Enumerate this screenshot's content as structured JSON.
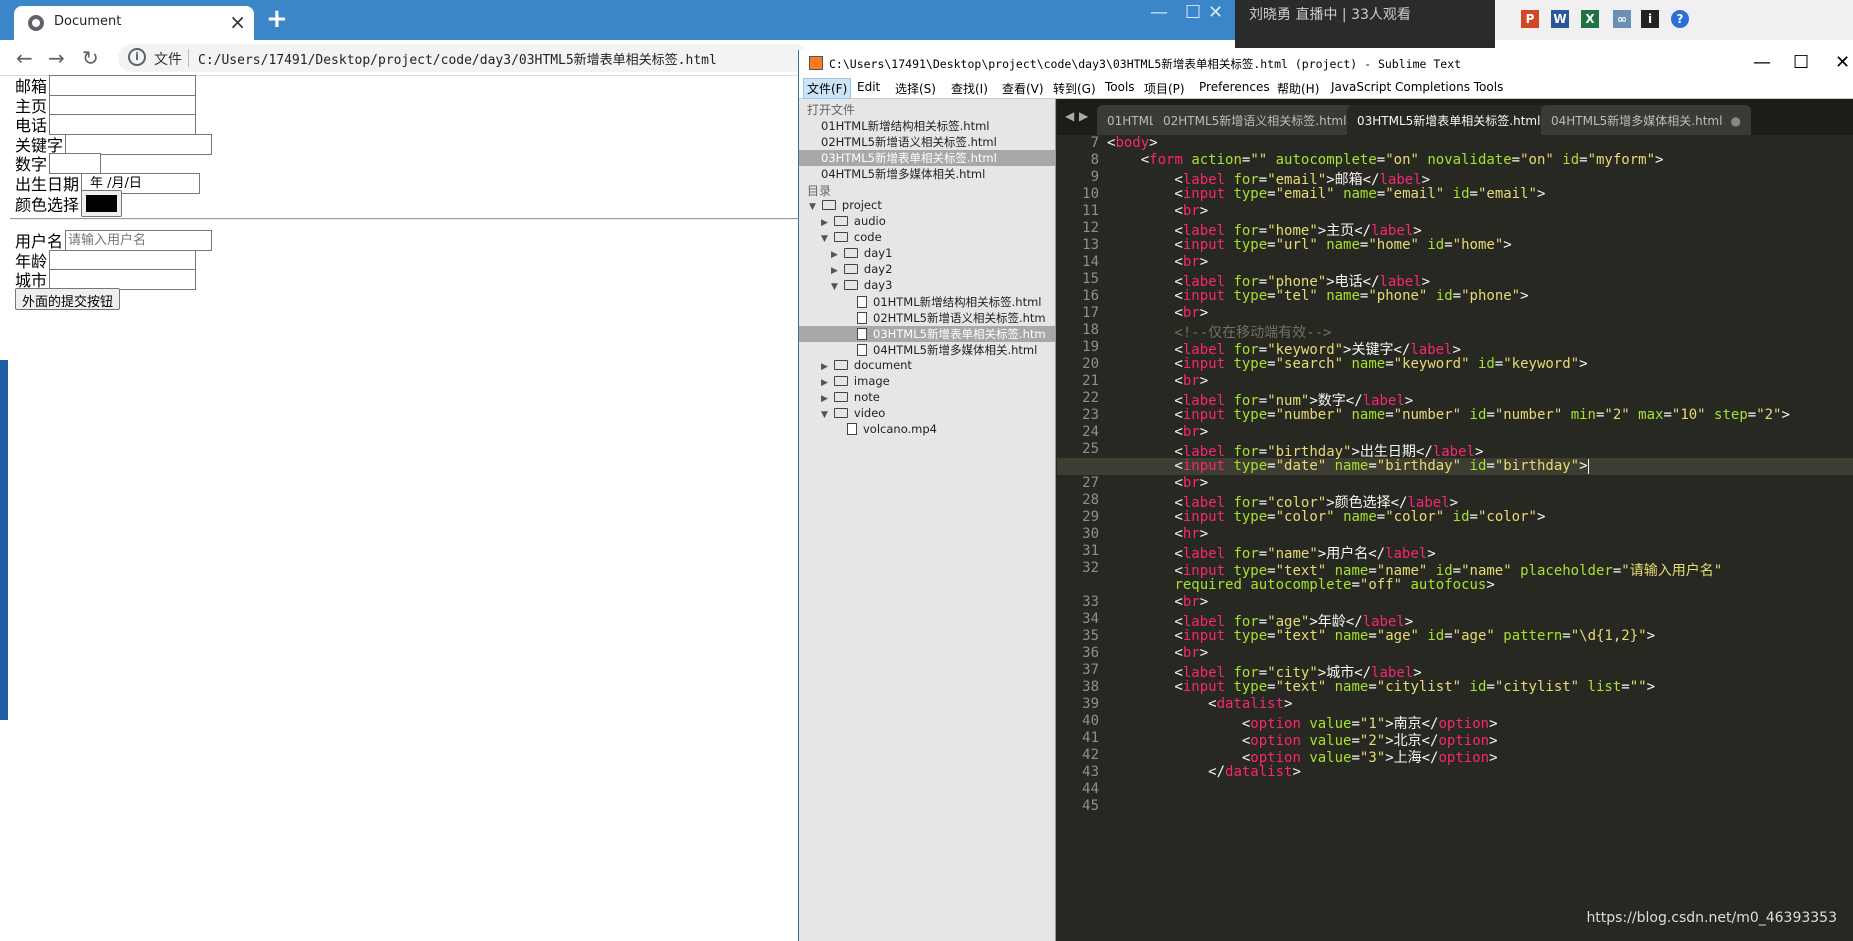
{
  "browser": {
    "tab_title": "Document",
    "address_label": "文件",
    "url": "C:/Users/17491/Desktop/project/code/day3/03HTML5新增表单相关标签.html"
  },
  "form": {
    "email_label": "邮箱",
    "home_label": "主页",
    "phone_label": "电话",
    "keyword_label": "关键字",
    "num_label": "数字",
    "birthday_label": "出生日期",
    "birthday_value": "年 /月/日",
    "color_label": "颜色选择",
    "color_value": "#000000",
    "name_label": "用户名",
    "name_placeholder": "请输入用户名",
    "age_label": "年龄",
    "city_label": "城市",
    "submit_label": "外面的提交按钮"
  },
  "overlay": {
    "live_text": "刘晓勇 直播中 | 33人观看"
  },
  "sublime": {
    "title": "C:\\Users\\17491\\Desktop\\project\\code\\day3\\03HTML5新增表单相关标签.html (project) - Sublime Text",
    "menu": [
      "文件(F)",
      "Edit",
      "选择(S)",
      "查找(I)",
      "查看(V)",
      "转到(G)",
      "Tools",
      "项目(P)",
      "Preferences",
      "帮助(H)",
      "JavaScript Completions Tools"
    ],
    "sidebar": {
      "open_files_header": "打开文件",
      "open_files": [
        "01HTML新增结构相关标签.html",
        "02HTML5新增语义相关标签.html",
        "03HTML5新增表单相关标签.html",
        "04HTML5新增多媒体相关.html"
      ],
      "folders_header": "目录",
      "tree": {
        "project": "project",
        "audio": "audio",
        "code": "code",
        "day1": "day1",
        "day2": "day2",
        "day3": "day3",
        "f1": "01HTML新增结构相关标签.html",
        "f2": "02HTML5新增语义相关标签.htm",
        "f3": "03HTML5新增表单相关标签.htm",
        "f4": "04HTML5新增多媒体相关.html",
        "document": "document",
        "image": "image",
        "note": "note",
        "video": "video",
        "volcano": "volcano.mp4"
      }
    },
    "tabs": [
      "01HTML新",
      "02HTML5新增语义相关标签.html",
      "03HTML5新增表单相关标签.html",
      "04HTML5新增多媒体相关.html"
    ],
    "line_numbers": [
      "7",
      "8",
      "9",
      "10",
      "11",
      "12",
      "13",
      "14",
      "15",
      "16",
      "17",
      "18",
      "19",
      "20",
      "21",
      "22",
      "23",
      "24",
      "25",
      "26",
      "27",
      "28",
      "29",
      "30",
      "31",
      "32",
      "33",
      "34",
      "35",
      "36",
      "37",
      "38",
      "39",
      "40",
      "41",
      "42",
      "43",
      "44",
      "45"
    ],
    "current_line": "26"
  },
  "watermark": "https://blog.csdn.net/m0_46393353",
  "colors": {
    "chrome_tabbar": "#3b86c8",
    "sublime_bg": "#272822",
    "tag": "#f92672",
    "attr": "#a6e22e",
    "string": "#e6db74",
    "comment": "#75715e"
  }
}
